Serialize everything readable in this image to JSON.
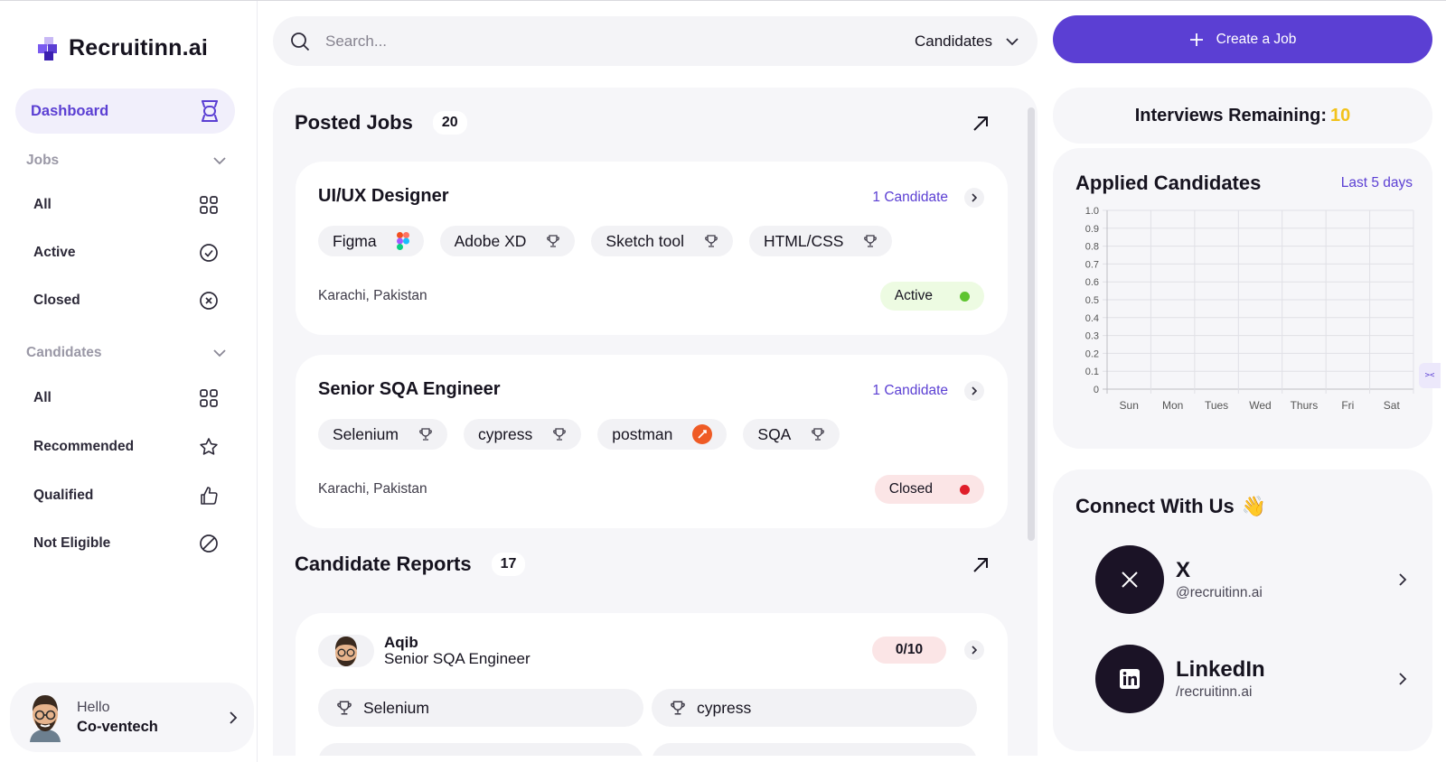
{
  "brand": {
    "name": "Recruitinn.ai"
  },
  "sidebar": {
    "dashboard_label": "Dashboard",
    "jobs_section": "Jobs",
    "jobs_items": [
      {
        "label": "All",
        "icon": "grid-icon"
      },
      {
        "label": "Active",
        "icon": "check-circle-icon"
      },
      {
        "label": "Closed",
        "icon": "x-circle-icon"
      }
    ],
    "candidates_section": "Candidates",
    "candidates_items": [
      {
        "label": "All",
        "icon": "grid-icon"
      },
      {
        "label": "Recommended",
        "icon": "star-icon"
      },
      {
        "label": "Qualified",
        "icon": "thumbs-up-icon"
      },
      {
        "label": "Not Eligible",
        "icon": "ban-icon"
      }
    ],
    "profile": {
      "greeting": "Hello",
      "name": "Co-ventech"
    }
  },
  "search": {
    "placeholder": "Search...",
    "scope": "Candidates"
  },
  "create_job_label": "Create a Job",
  "posted_jobs": {
    "title": "Posted Jobs",
    "count": "20",
    "jobs": [
      {
        "title": "UI/UX Designer",
        "candidates": "1 Candidate",
        "skills": [
          "Figma",
          "Adobe XD",
          "Sketch tool",
          "HTML/CSS"
        ],
        "location": "Karachi, Pakistan",
        "status": "Active",
        "status_color": "#5ec42f",
        "status_bg": "#edfbe2"
      },
      {
        "title": "Senior SQA Engineer",
        "candidates": "1 Candidate",
        "skills": [
          "Selenium",
          "cypress",
          "postman",
          "SQA"
        ],
        "location": "Karachi, Pakistan",
        "status": "Closed",
        "status_color": "#e01e2a",
        "status_bg": "#fbe5e6"
      }
    ]
  },
  "candidate_reports": {
    "title": "Candidate Reports",
    "count": "17",
    "report": {
      "name": "Aqib",
      "role": "Senior SQA Engineer",
      "score": "0/10",
      "skills": [
        "Selenium",
        "cypress"
      ]
    }
  },
  "interviews": {
    "label": "Interviews Remaining:",
    "value": "10"
  },
  "chart_data": {
    "type": "line",
    "title": "Applied Candidates",
    "range_label": "Last 5 days",
    "categories": [
      "Sun",
      "Mon",
      "Tues",
      "Wed",
      "Thurs",
      "Fri",
      "Sat"
    ],
    "y_ticks": [
      "1.0",
      "0.9",
      "0.8",
      "0.7",
      "0.6",
      "0.5",
      "0.4",
      "0.3",
      "0.2",
      "0.1",
      "0"
    ],
    "ylim": [
      0,
      1
    ],
    "series": [],
    "grid": true
  },
  "connect": {
    "title": "Connect With Us",
    "emoji": "👋",
    "links": [
      {
        "name": "X",
        "handle": "@recruitinn.ai",
        "icon": "x-logo-icon"
      },
      {
        "name": "LinkedIn",
        "handle": "/recruitinn.ai",
        "icon": "linkedin-icon"
      }
    ]
  },
  "colors": {
    "accent": "#5b3fd3",
    "highlight": "#f2c21b",
    "panel": "#f6f6f9"
  }
}
